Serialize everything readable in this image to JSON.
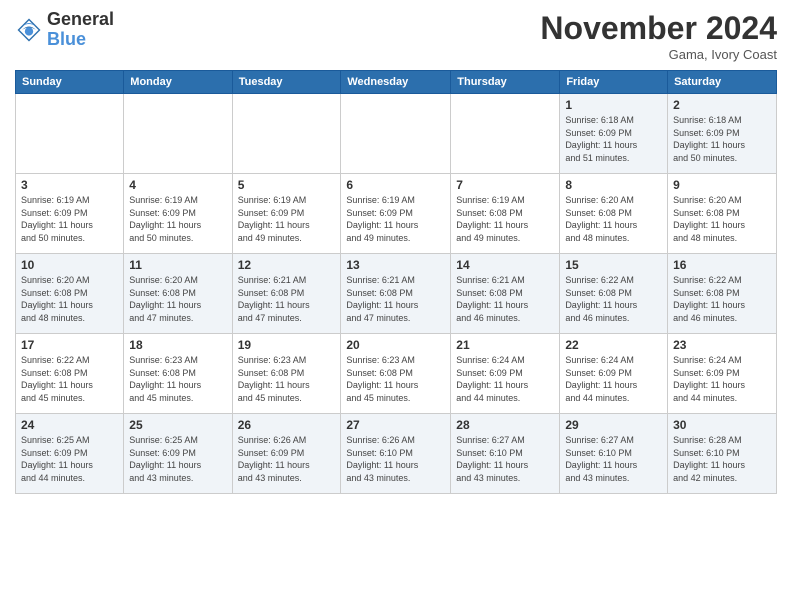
{
  "header": {
    "logo_line1": "General",
    "logo_line2": "Blue",
    "month_title": "November 2024",
    "location": "Gama, Ivory Coast"
  },
  "weekdays": [
    "Sunday",
    "Monday",
    "Tuesday",
    "Wednesday",
    "Thursday",
    "Friday",
    "Saturday"
  ],
  "weeks": [
    [
      {
        "day": "",
        "info": ""
      },
      {
        "day": "",
        "info": ""
      },
      {
        "day": "",
        "info": ""
      },
      {
        "day": "",
        "info": ""
      },
      {
        "day": "",
        "info": ""
      },
      {
        "day": "1",
        "info": "Sunrise: 6:18 AM\nSunset: 6:09 PM\nDaylight: 11 hours\nand 51 minutes."
      },
      {
        "day": "2",
        "info": "Sunrise: 6:18 AM\nSunset: 6:09 PM\nDaylight: 11 hours\nand 50 minutes."
      }
    ],
    [
      {
        "day": "3",
        "info": "Sunrise: 6:19 AM\nSunset: 6:09 PM\nDaylight: 11 hours\nand 50 minutes."
      },
      {
        "day": "4",
        "info": "Sunrise: 6:19 AM\nSunset: 6:09 PM\nDaylight: 11 hours\nand 50 minutes."
      },
      {
        "day": "5",
        "info": "Sunrise: 6:19 AM\nSunset: 6:09 PM\nDaylight: 11 hours\nand 49 minutes."
      },
      {
        "day": "6",
        "info": "Sunrise: 6:19 AM\nSunset: 6:09 PM\nDaylight: 11 hours\nand 49 minutes."
      },
      {
        "day": "7",
        "info": "Sunrise: 6:19 AM\nSunset: 6:08 PM\nDaylight: 11 hours\nand 49 minutes."
      },
      {
        "day": "8",
        "info": "Sunrise: 6:20 AM\nSunset: 6:08 PM\nDaylight: 11 hours\nand 48 minutes."
      },
      {
        "day": "9",
        "info": "Sunrise: 6:20 AM\nSunset: 6:08 PM\nDaylight: 11 hours\nand 48 minutes."
      }
    ],
    [
      {
        "day": "10",
        "info": "Sunrise: 6:20 AM\nSunset: 6:08 PM\nDaylight: 11 hours\nand 48 minutes."
      },
      {
        "day": "11",
        "info": "Sunrise: 6:20 AM\nSunset: 6:08 PM\nDaylight: 11 hours\nand 47 minutes."
      },
      {
        "day": "12",
        "info": "Sunrise: 6:21 AM\nSunset: 6:08 PM\nDaylight: 11 hours\nand 47 minutes."
      },
      {
        "day": "13",
        "info": "Sunrise: 6:21 AM\nSunset: 6:08 PM\nDaylight: 11 hours\nand 47 minutes."
      },
      {
        "day": "14",
        "info": "Sunrise: 6:21 AM\nSunset: 6:08 PM\nDaylight: 11 hours\nand 46 minutes."
      },
      {
        "day": "15",
        "info": "Sunrise: 6:22 AM\nSunset: 6:08 PM\nDaylight: 11 hours\nand 46 minutes."
      },
      {
        "day": "16",
        "info": "Sunrise: 6:22 AM\nSunset: 6:08 PM\nDaylight: 11 hours\nand 46 minutes."
      }
    ],
    [
      {
        "day": "17",
        "info": "Sunrise: 6:22 AM\nSunset: 6:08 PM\nDaylight: 11 hours\nand 45 minutes."
      },
      {
        "day": "18",
        "info": "Sunrise: 6:23 AM\nSunset: 6:08 PM\nDaylight: 11 hours\nand 45 minutes."
      },
      {
        "day": "19",
        "info": "Sunrise: 6:23 AM\nSunset: 6:08 PM\nDaylight: 11 hours\nand 45 minutes."
      },
      {
        "day": "20",
        "info": "Sunrise: 6:23 AM\nSunset: 6:08 PM\nDaylight: 11 hours\nand 45 minutes."
      },
      {
        "day": "21",
        "info": "Sunrise: 6:24 AM\nSunset: 6:09 PM\nDaylight: 11 hours\nand 44 minutes."
      },
      {
        "day": "22",
        "info": "Sunrise: 6:24 AM\nSunset: 6:09 PM\nDaylight: 11 hours\nand 44 minutes."
      },
      {
        "day": "23",
        "info": "Sunrise: 6:24 AM\nSunset: 6:09 PM\nDaylight: 11 hours\nand 44 minutes."
      }
    ],
    [
      {
        "day": "24",
        "info": "Sunrise: 6:25 AM\nSunset: 6:09 PM\nDaylight: 11 hours\nand 44 minutes."
      },
      {
        "day": "25",
        "info": "Sunrise: 6:25 AM\nSunset: 6:09 PM\nDaylight: 11 hours\nand 43 minutes."
      },
      {
        "day": "26",
        "info": "Sunrise: 6:26 AM\nSunset: 6:09 PM\nDaylight: 11 hours\nand 43 minutes."
      },
      {
        "day": "27",
        "info": "Sunrise: 6:26 AM\nSunset: 6:10 PM\nDaylight: 11 hours\nand 43 minutes."
      },
      {
        "day": "28",
        "info": "Sunrise: 6:27 AM\nSunset: 6:10 PM\nDaylight: 11 hours\nand 43 minutes."
      },
      {
        "day": "29",
        "info": "Sunrise: 6:27 AM\nSunset: 6:10 PM\nDaylight: 11 hours\nand 43 minutes."
      },
      {
        "day": "30",
        "info": "Sunrise: 6:28 AM\nSunset: 6:10 PM\nDaylight: 11 hours\nand 42 minutes."
      }
    ]
  ]
}
